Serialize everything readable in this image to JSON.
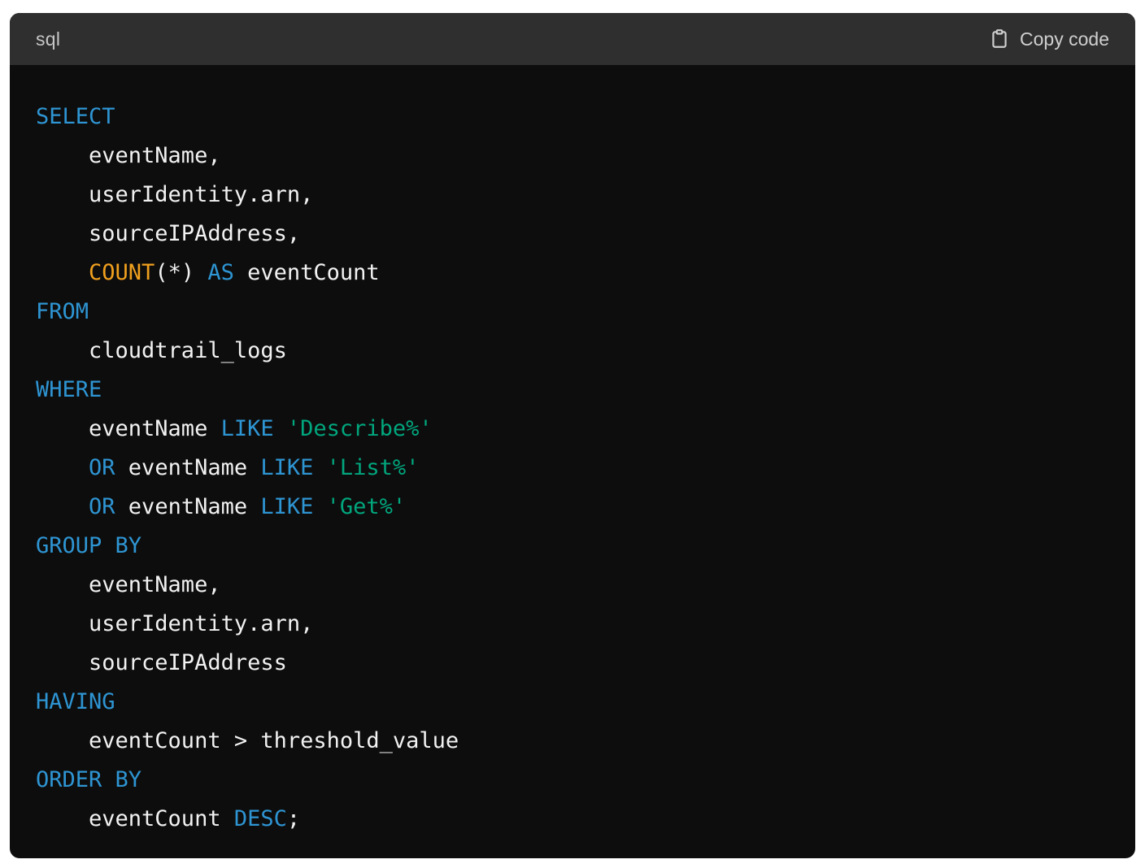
{
  "header": {
    "language": "sql",
    "copy_label": "Copy code",
    "copy_icon": "clipboard-icon"
  },
  "colors": {
    "keyword": "#2e95d3",
    "function": "#f0a01e",
    "string": "#00a67d",
    "text": "#f2f2f2",
    "background": "#0d0d0d",
    "header_background": "#2f2f2f"
  },
  "code": {
    "lines": [
      [
        {
          "t": "kw",
          "v": "SELECT"
        }
      ],
      [
        {
          "t": "p",
          "v": "    eventName,"
        }
      ],
      [
        {
          "t": "p",
          "v": "    userIdentity.arn,"
        }
      ],
      [
        {
          "t": "p",
          "v": "    sourceIPAddress,"
        }
      ],
      [
        {
          "t": "p",
          "v": "    "
        },
        {
          "t": "fn",
          "v": "COUNT"
        },
        {
          "t": "p",
          "v": "(*) "
        },
        {
          "t": "kw",
          "v": "AS"
        },
        {
          "t": "p",
          "v": " eventCount"
        }
      ],
      [
        {
          "t": "kw",
          "v": "FROM"
        }
      ],
      [
        {
          "t": "p",
          "v": "    cloudtrail_logs"
        }
      ],
      [
        {
          "t": "kw",
          "v": "WHERE"
        }
      ],
      [
        {
          "t": "p",
          "v": "    eventName "
        },
        {
          "t": "kw",
          "v": "LIKE"
        },
        {
          "t": "p",
          "v": " "
        },
        {
          "t": "str",
          "v": "'Describe%'"
        }
      ],
      [
        {
          "t": "p",
          "v": "    "
        },
        {
          "t": "kw",
          "v": "OR"
        },
        {
          "t": "p",
          "v": " eventName "
        },
        {
          "t": "kw",
          "v": "LIKE"
        },
        {
          "t": "p",
          "v": " "
        },
        {
          "t": "str",
          "v": "'List%'"
        }
      ],
      [
        {
          "t": "p",
          "v": "    "
        },
        {
          "t": "kw",
          "v": "OR"
        },
        {
          "t": "p",
          "v": " eventName "
        },
        {
          "t": "kw",
          "v": "LIKE"
        },
        {
          "t": "p",
          "v": " "
        },
        {
          "t": "str",
          "v": "'Get%'"
        }
      ],
      [
        {
          "t": "kw",
          "v": "GROUP BY"
        }
      ],
      [
        {
          "t": "p",
          "v": "    eventName,"
        }
      ],
      [
        {
          "t": "p",
          "v": "    userIdentity.arn,"
        }
      ],
      [
        {
          "t": "p",
          "v": "    sourceIPAddress"
        }
      ],
      [
        {
          "t": "kw",
          "v": "HAVING"
        }
      ],
      [
        {
          "t": "p",
          "v": "    eventCount > threshold_value"
        }
      ],
      [
        {
          "t": "kw",
          "v": "ORDER BY"
        }
      ],
      [
        {
          "t": "p",
          "v": "    eventCount "
        },
        {
          "t": "kw",
          "v": "DESC"
        },
        {
          "t": "p",
          "v": ";"
        }
      ]
    ]
  }
}
